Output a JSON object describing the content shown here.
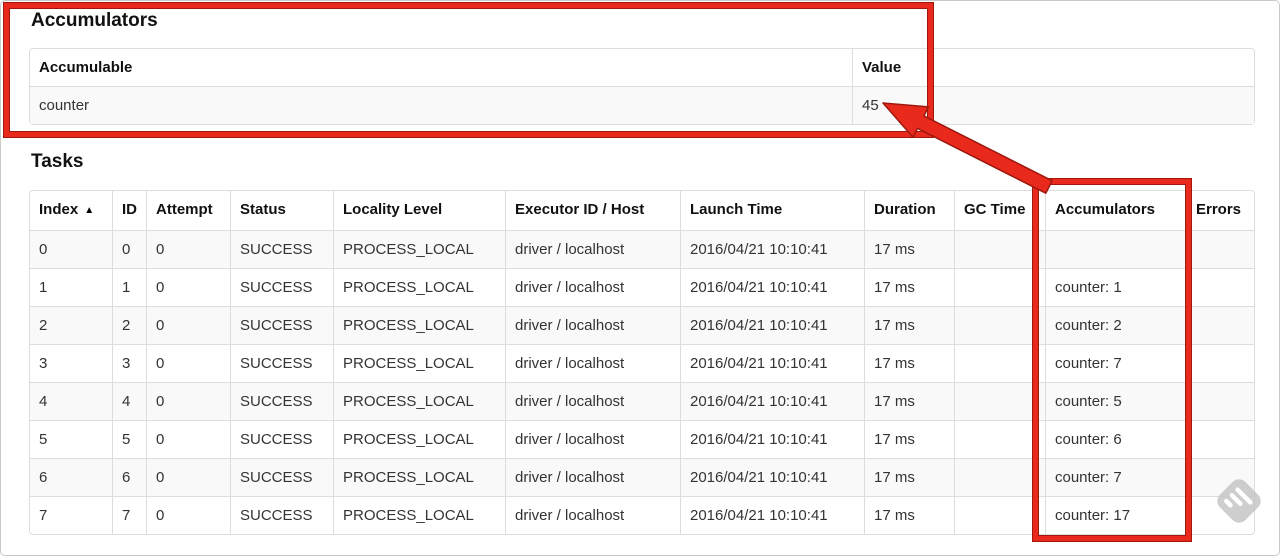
{
  "colors": {
    "annotation_red": "#e8291c",
    "annotation_red_outline": "#9e180e",
    "table_border": "#dddddd",
    "stripe_background": "#f9f9f9",
    "text": "#333333",
    "watermark_gray": "#c9c9c9"
  },
  "accumulators_section": {
    "title": "Accumulators",
    "table": {
      "headers": {
        "accumulable": "Accumulable",
        "value": "Value"
      },
      "rows": [
        {
          "accumulable": "counter",
          "value": "45"
        }
      ]
    }
  },
  "tasks_section": {
    "title": "Tasks",
    "table": {
      "headers": [
        "Index",
        "ID",
        "Attempt",
        "Status",
        "Locality Level",
        "Executor ID / Host",
        "Launch Time",
        "Duration",
        "GC Time",
        "Accumulators",
        "Errors"
      ],
      "sort": {
        "column": "Index",
        "direction_icon": "▲"
      },
      "rows": [
        [
          "0",
          "0",
          "0",
          "SUCCESS",
          "PROCESS_LOCAL",
          "driver / localhost",
          "2016/04/21 10:10:41",
          "17 ms",
          "",
          "",
          ""
        ],
        [
          "1",
          "1",
          "0",
          "SUCCESS",
          "PROCESS_LOCAL",
          "driver / localhost",
          "2016/04/21 10:10:41",
          "17 ms",
          "",
          "counter: 1",
          ""
        ],
        [
          "2",
          "2",
          "0",
          "SUCCESS",
          "PROCESS_LOCAL",
          "driver / localhost",
          "2016/04/21 10:10:41",
          "17 ms",
          "",
          "counter: 2",
          ""
        ],
        [
          "3",
          "3",
          "0",
          "SUCCESS",
          "PROCESS_LOCAL",
          "driver / localhost",
          "2016/04/21 10:10:41",
          "17 ms",
          "",
          "counter: 7",
          ""
        ],
        [
          "4",
          "4",
          "0",
          "SUCCESS",
          "PROCESS_LOCAL",
          "driver / localhost",
          "2016/04/21 10:10:41",
          "17 ms",
          "",
          "counter: 5",
          ""
        ],
        [
          "5",
          "5",
          "0",
          "SUCCESS",
          "PROCESS_LOCAL",
          "driver / localhost",
          "2016/04/21 10:10:41",
          "17 ms",
          "",
          "counter: 6",
          ""
        ],
        [
          "6",
          "6",
          "0",
          "SUCCESS",
          "PROCESS_LOCAL",
          "driver / localhost",
          "2016/04/21 10:10:41",
          "17 ms",
          "",
          "counter: 7",
          ""
        ],
        [
          "7",
          "7",
          "0",
          "SUCCESS",
          "PROCESS_LOCAL",
          "driver / localhost",
          "2016/04/21 10:10:41",
          "17 ms",
          "",
          "counter: 17",
          ""
        ]
      ]
    }
  }
}
